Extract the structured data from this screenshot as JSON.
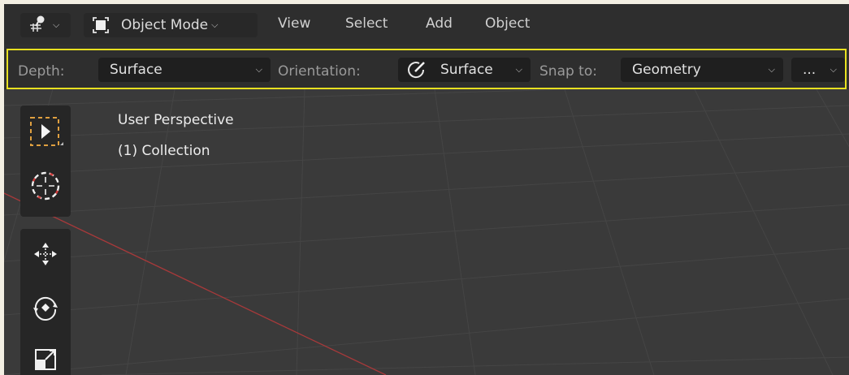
{
  "header": {
    "editor_type_icon": "viewport-gizmo-icon",
    "mode_icon": "object-mode-icon",
    "mode_label": "Object Mode",
    "menus": [
      "View",
      "Select",
      "Add",
      "Object"
    ]
  },
  "tool_settings": {
    "depth_label": "Depth:",
    "depth_value": "Surface",
    "orientation_label": "Orientation:",
    "orientation_icon": "orientation-surface-icon",
    "orientation_value": "Surface",
    "snap_label": "Snap to:",
    "snap_value": "Geometry",
    "more_value": "..."
  },
  "viewport": {
    "view_name": "User Perspective",
    "collection_label": "(1) Collection"
  },
  "toolbox": {
    "tools": [
      "select-box-icon",
      "cursor-icon",
      "move-icon",
      "rotate-icon",
      "scale-icon"
    ]
  },
  "colors": {
    "highlight_border": "#e8e020",
    "x_axis": "#b23a3a",
    "viewport_bg": "#3a3a3a"
  }
}
